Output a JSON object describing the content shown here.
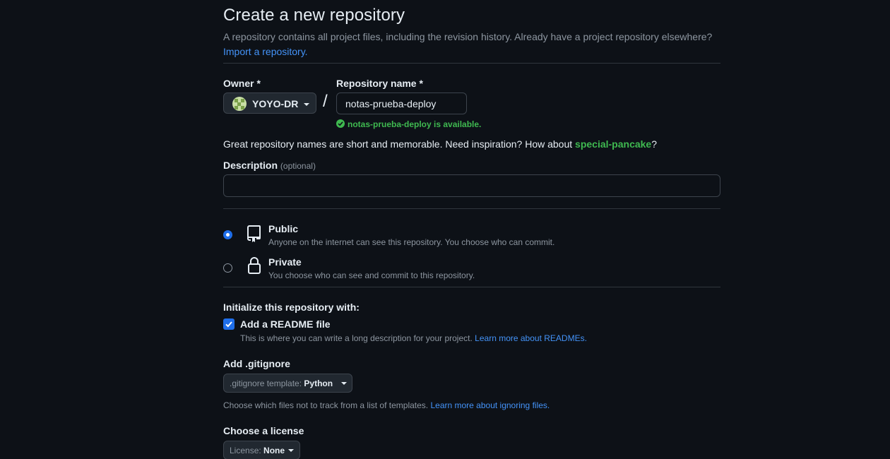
{
  "header": {
    "title": "Create a new repository",
    "subtitle": "A repository contains all project files, including the revision history. Already have a project repository elsewhere?",
    "import_link": "Import a repository."
  },
  "owner": {
    "label": "Owner *",
    "value": "YOYO-DR"
  },
  "repo_name": {
    "label": "Repository name *",
    "value": "notas-prueba-deploy",
    "availability": "notas-prueba-deploy is available."
  },
  "inspiration": {
    "text": "Great repository names are short and memorable. Need inspiration? How about",
    "suggestion": "special-pancake",
    "suffix": "?"
  },
  "description": {
    "label": "Description",
    "optional": "(optional)",
    "value": ""
  },
  "visibility": {
    "selected": "public",
    "options": [
      {
        "title": "Public",
        "desc": "Anyone on the internet can see this repository. You choose who can commit.",
        "icon": "repo-icon"
      },
      {
        "title": "Private",
        "desc": "You choose who can see and commit to this repository.",
        "icon": "lock-icon"
      }
    ]
  },
  "init": {
    "heading": "Initialize this repository with:",
    "readme_label": "Add a README file",
    "readme_checked": true,
    "readme_desc": "This is where you can write a long description for your project.",
    "readme_link": "Learn more about READMEs."
  },
  "gitignore": {
    "heading": "Add .gitignore",
    "key": ".gitignore template:",
    "value": "Python",
    "desc": "Choose which files not to track from a list of templates.",
    "link": "Learn more about ignoring files."
  },
  "license": {
    "heading": "Choose a license",
    "key": "License:",
    "value": "None"
  },
  "colors": {
    "background": "#0d1117",
    "accent": "#1f6feb",
    "link": "#4493f8",
    "success": "#3fb950",
    "muted": "#8d96a0"
  }
}
